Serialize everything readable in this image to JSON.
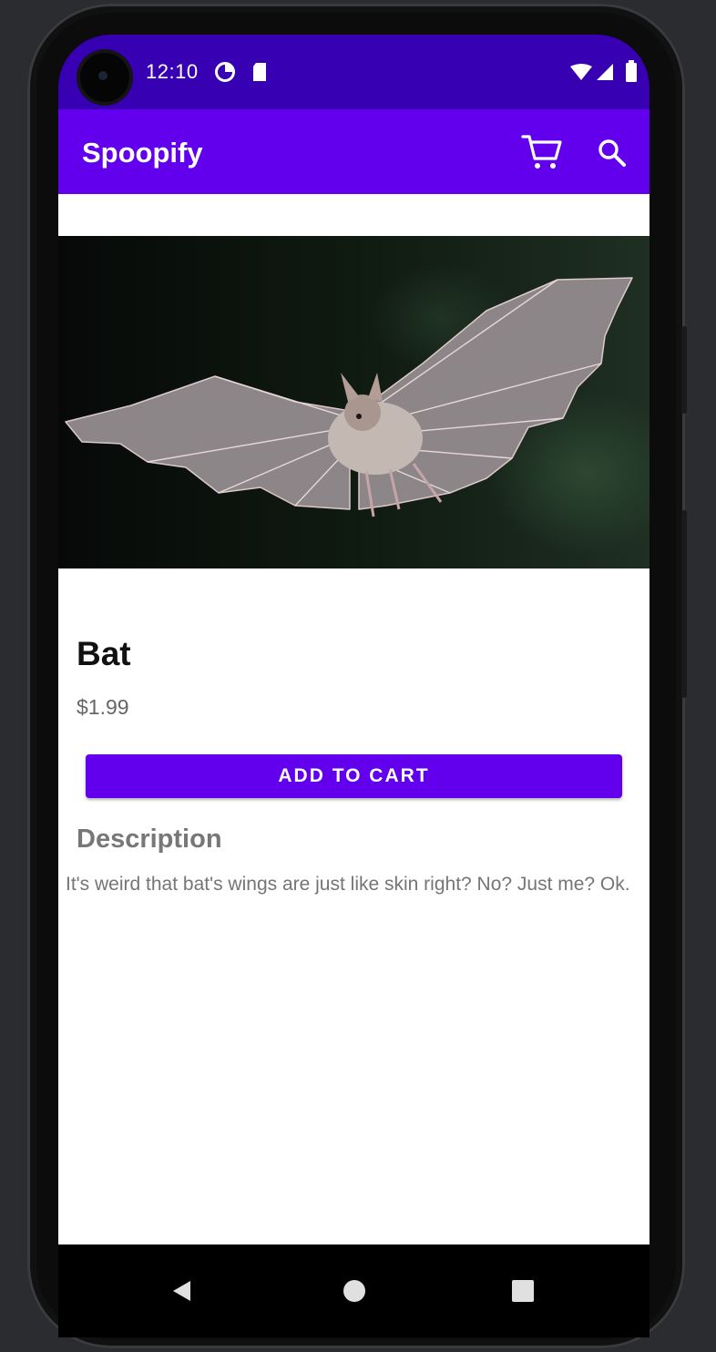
{
  "status_bar": {
    "time": "12:10",
    "icons": [
      "data-saver-icon",
      "sd-card-icon",
      "wifi-icon",
      "cell-signal-icon",
      "battery-icon"
    ]
  },
  "app_bar": {
    "title": "Spoopify",
    "actions": [
      "cart-icon",
      "search-icon"
    ]
  },
  "product": {
    "image": "bat-photo",
    "name": "Bat",
    "price": "$1.99",
    "add_to_cart_label": "ADD TO CART",
    "description_heading": "Description",
    "description": "It's weird that bat's wings are just like skin right? No? Just me? Ok."
  },
  "nav_bar": {
    "buttons": [
      "back-icon",
      "home-icon",
      "recents-icon"
    ]
  },
  "colors": {
    "status_bar": "#3700b3",
    "primary": "#6200ee",
    "background": "#ffffff"
  }
}
